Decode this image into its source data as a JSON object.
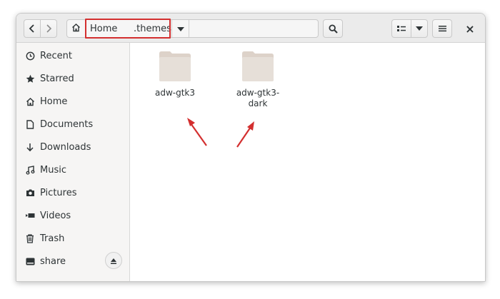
{
  "toolbar": {
    "back_icon": "chevron-left-icon",
    "forward_icon": "chevron-right-icon",
    "home_icon": "home-icon",
    "dropdown_icon": "triangle-down-icon",
    "search_icon": "search-icon",
    "view_icon": "list-view-icon",
    "menu_icon": "hamburger-menu-icon",
    "close_label": "×"
  },
  "pathbar": {
    "crumbs": [
      "Home",
      ".themes"
    ]
  },
  "sidebar": {
    "items": [
      {
        "label": "Recent",
        "icon": "clock-icon"
      },
      {
        "label": "Starred",
        "icon": "star-icon"
      },
      {
        "label": "Home",
        "icon": "home-icon"
      },
      {
        "label": "Documents",
        "icon": "document-icon"
      },
      {
        "label": "Downloads",
        "icon": "download-icon"
      },
      {
        "label": "Music",
        "icon": "music-icon"
      },
      {
        "label": "Pictures",
        "icon": "camera-icon"
      },
      {
        "label": "Videos",
        "icon": "video-icon"
      },
      {
        "label": "Trash",
        "icon": "trash-icon"
      },
      {
        "label": "share",
        "icon": "drive-icon"
      }
    ]
  },
  "files": [
    {
      "name": "adw-gtk3",
      "icon": "folder-icon"
    },
    {
      "name": "adw-gtk3-dark",
      "icon": "folder-icon"
    }
  ],
  "colors": {
    "highlight": "#d32f2f",
    "arrow": "#d32f2f",
    "folder": "#e4ddd6"
  }
}
